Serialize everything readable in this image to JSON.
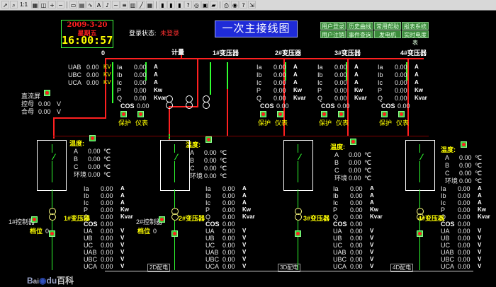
{
  "toolbar": {
    "zoom_label": "1:1"
  },
  "clock": {
    "date": "2009-3-20",
    "weekday": "星期五",
    "time": "16:00:57"
  },
  "login": {
    "label": "登录状态:",
    "status": "未登录"
  },
  "title": "一次主接线图",
  "menu": {
    "row1": [
      "用户登录",
      "历史曲线",
      "常用帮助",
      "报表系统"
    ],
    "row2": [
      "用户注销",
      "事件查询",
      "发电机",
      "实时电度表"
    ]
  },
  "incoming": {
    "labels": [
      "0",
      "计量"
    ],
    "rows": [
      [
        "UAB",
        "0.00",
        "KV"
      ],
      [
        "UBC",
        "0.00",
        "KV"
      ],
      [
        "UCA",
        "0.00",
        "KV"
      ]
    ],
    "dc": [
      [
        "直流屏"
      ],
      [
        "控母",
        "0.00",
        "V"
      ],
      [
        "合母",
        "0.00",
        "V"
      ]
    ]
  },
  "transformers": [
    {
      "name": "1#变压器",
      "ia": "0.00",
      "ib": "0.00",
      "ic": "0.00",
      "p": "0.00",
      "q": "0.00",
      "cos": "0.00"
    },
    {
      "name": "2#变压器",
      "ia": "0.00",
      "ib": "0.00",
      "ic": "0.00",
      "p": "0.00",
      "q": "0.00",
      "cos": "0.00"
    },
    {
      "name": "3#变压器",
      "ia": "0.00",
      "ib": "0.00",
      "ic": "0.00",
      "p": "0.00",
      "q": "0.00",
      "cos": "0.00"
    },
    {
      "name": "4#变压器",
      "ia": "0.00",
      "ib": "0.00",
      "ic": "0.00",
      "p": "0.00",
      "q": "0.00",
      "cos": "0.00"
    }
  ],
  "top_labels": {
    "ia": "Ia",
    "ib": "Ib",
    "ic": "Ic",
    "p": "P",
    "q": "Q",
    "cos": "COS",
    "a": "A",
    "kw": "Kw",
    "kvar": "Kvar",
    "prot": "保护",
    "inst": "仪表"
  },
  "temp": {
    "title": "温度:",
    "rows": [
      "A",
      "B",
      "C",
      "环境"
    ],
    "vals": [
      "0.00",
      "0.00",
      "0.00",
      "0.00"
    ],
    "unit": "℃"
  },
  "bottom_labels": [
    "Ia",
    "Ib",
    "Ic",
    "P",
    "Q",
    "COS",
    "UA",
    "UB",
    "UC",
    "UAB",
    "UBC",
    "UCA"
  ],
  "bottom_units": [
    "A",
    "A",
    "A",
    "Kw",
    "Kvar",
    "",
    "V",
    "V",
    "V",
    "V",
    "V",
    "V"
  ],
  "bottom_value": "0.00",
  "low_sections": [
    {
      "xfmr": "1#变压器",
      "ctrl": "1#控制器",
      "tap": "档位",
      "tap_val": "0"
    },
    {
      "xfmr": "2#变压器",
      "ctrl": "2#控制器",
      "tap": "档位",
      "tap_val": "0"
    },
    {
      "xfmr": "3#变压器",
      "ctrl": "",
      "tap": "",
      "tap_val": ""
    },
    {
      "xfmr": "4#变压器",
      "ctrl": "",
      "tap": "",
      "tap_val": ""
    }
  ],
  "busbar_labels": [
    "2D配电",
    "3D配电",
    "4D配电"
  ],
  "watermark": "百科",
  "colors": {
    "bus": "#ff2020",
    "live": "#30ff30",
    "title_bg": "#1f2bd8",
    "menu_bg": "#3c8c3c",
    "value": "#e8e8e8",
    "label": "#ffff00"
  }
}
